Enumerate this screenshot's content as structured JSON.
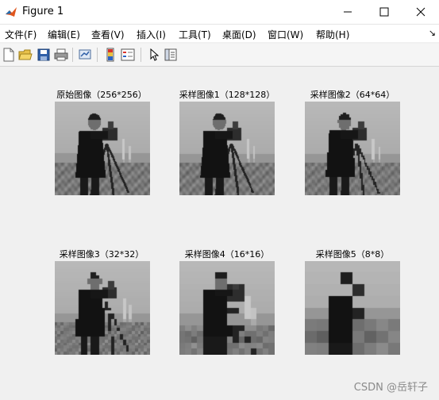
{
  "window": {
    "title": "Figure 1"
  },
  "menubar": {
    "items": [
      "文件(F)",
      "编辑(E)",
      "查看(V)",
      "插入(I)",
      "工具(T)",
      "桌面(D)",
      "窗口(W)",
      "帮助(H)"
    ]
  },
  "toolbar": {
    "icons": [
      "new-figure-icon",
      "open-file-icon",
      "save-icon",
      "print-icon",
      "link-plot-icon",
      "insert-colorbar-icon",
      "insert-legend-icon",
      "edit-plot-arrow-icon",
      "property-inspector-icon"
    ]
  },
  "subplots": [
    {
      "title": "原始图像（256*256）",
      "resolution": 256
    },
    {
      "title": "采样图像1（128*128）",
      "resolution": 128
    },
    {
      "title": "采样图像2（64*64）",
      "resolution": 64
    },
    {
      "title": "采样图像3（32*32）",
      "resolution": 32
    },
    {
      "title": "采样图像4（16*16）",
      "resolution": 16
    },
    {
      "title": "采样图像5（8*8）",
      "resolution": 8
    }
  ],
  "watermark": "CSDN @岳轩子"
}
